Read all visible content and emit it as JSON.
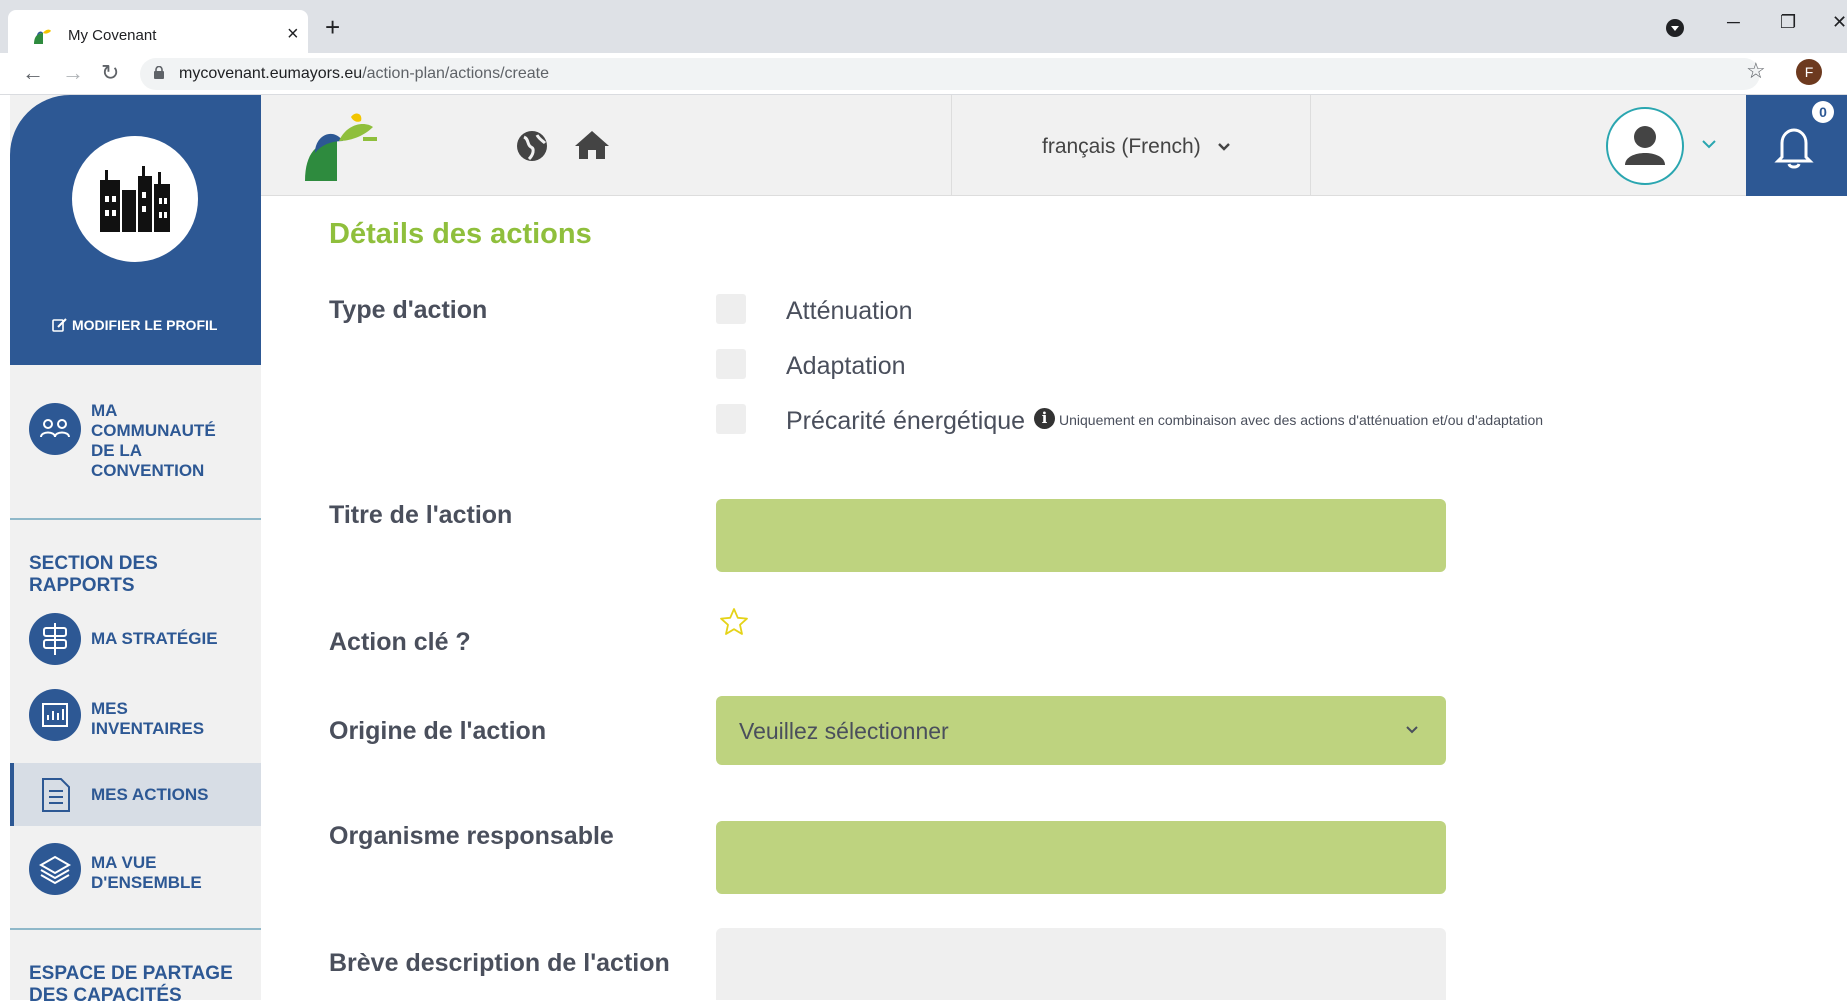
{
  "browser": {
    "tab_title": "My Covenant",
    "url_host": "mycovenant.eumayors.eu",
    "url_path": "/action-plan/actions/create",
    "profile_letter": "F"
  },
  "sidebar": {
    "edit_profile": "MODIFIER LE PROFIL",
    "community": [
      "MA",
      "COMMUNAUTÉ",
      "DE LA",
      "CONVENTION"
    ],
    "reports_section": [
      "SECTION DES",
      "RAPPORTS"
    ],
    "items": [
      {
        "label_lines": [
          "MA STRATÉGIE"
        ]
      },
      {
        "label_lines": [
          "MES",
          "INVENTAIRES"
        ]
      },
      {
        "label_lines": [
          "MES ACTIONS"
        ]
      },
      {
        "label_lines": [
          "MA VUE",
          "D'ENSEMBLE"
        ]
      }
    ],
    "sharing_section": [
      "ESPACE DE PARTAGE",
      "DES CAPACITÉS"
    ]
  },
  "topbar": {
    "language": "français (French)",
    "notification_count": "0"
  },
  "form": {
    "title": "Détails des actions",
    "action_type_label": "Type d'action",
    "action_types": [
      "Atténuation",
      "Adaptation",
      "Précarité énergétique"
    ],
    "hint": "Uniquement en combinaison avec des actions d'atténuation et/ou d'adaptation",
    "action_title_label": "Titre de l'action",
    "action_title_value": "",
    "key_action_label": "Action clé ?",
    "origin_label": "Origine de l'action",
    "origin_selected": "Veuillez sélectionner",
    "responsible_label": "Organisme responsable",
    "responsible_value": "",
    "description_label": "Brève description de l'action",
    "description_value": ""
  },
  "colors": {
    "brand_blue": "#2d5894",
    "brand_green": "#8fbf3c",
    "field_green": "#bed37f",
    "teal": "#2aa6b0"
  }
}
